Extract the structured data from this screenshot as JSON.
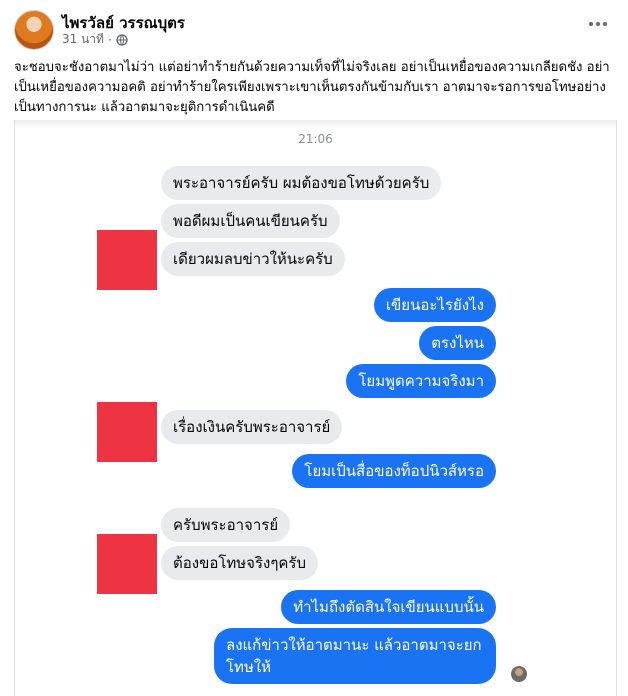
{
  "post": {
    "author": "ไพรวัลย์ วรรณบุตร",
    "time": "31 นาที",
    "body": "จะชอบจะชังอาตมาไม่ว่า แต่อย่าทำร้ายกันด้วยความเท็จที่ไม่จริงเลย อย่าเป็นเหยื่อของความเกลียดชัง อย่าเป็นเหยื่อของความอคติ อย่าทำร้ายใครเพียงเพราะเขาเห็นตรงกันข้ามกับเรา อาตมาจะรอการขอโทษอย่างเป็นทางการนะ แล้วอาตมาจะยุติการดำเนินคดี",
    "icons": {
      "privacy": "globe-icon",
      "menu": "more-options-icon"
    }
  },
  "chat": {
    "timestamp": "21:06",
    "messages": [
      {
        "from": "them",
        "text": "พระอาจารย์ครับ ผมต้องขอโทษด้วยครับ"
      },
      {
        "from": "them",
        "text": "พอดีผมเป็นคนเขียนครับ"
      },
      {
        "from": "them",
        "text": "เดียวผมลบข่าวให้นะครับ"
      },
      {
        "from": "me",
        "text": "เขียนอะไรยังไง"
      },
      {
        "from": "me",
        "text": "ตรงไหน"
      },
      {
        "from": "me",
        "text": "โยมพูดความจริงมา"
      },
      {
        "from": "them",
        "text": "เรื่องเงินครับพระอาจารย์"
      },
      {
        "from": "me",
        "text": "โยมเป็นสื่อของท็อปนิวส์หรอ"
      },
      {
        "from": "them",
        "text": "ครับพระอาจารย์"
      },
      {
        "from": "them",
        "text": "ต้องขอโทษจริงๆครับ"
      },
      {
        "from": "me",
        "text": "ทำไมถึงตัดสินใจเขียนแบบนั้น"
      },
      {
        "from": "me",
        "text": "ลงแก้ข่าวให้อาตมานะ แล้วอาตมาจะยกโทษให้"
      }
    ],
    "colors": {
      "incoming": "#e9eaee",
      "outgoing": "#1a73f2",
      "redacted": "#ee3443"
    }
  }
}
